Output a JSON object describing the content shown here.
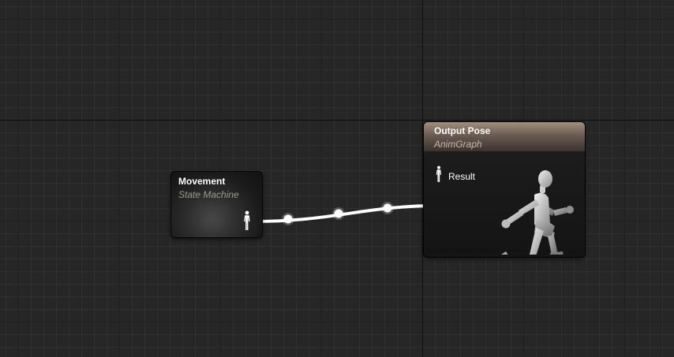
{
  "nodes": {
    "movement": {
      "title": "Movement",
      "subtitle": "State Machine"
    },
    "output_pose": {
      "title": "Output Pose",
      "subtitle": "AnimGraph",
      "pin_label": "Result"
    }
  },
  "colors": {
    "wire": "#ffffff",
    "output_header": "#a48d7d",
    "grid_background": "#262626"
  },
  "icons": {
    "pose_pin": "person-icon",
    "preview": "running-mannequin-icon"
  }
}
